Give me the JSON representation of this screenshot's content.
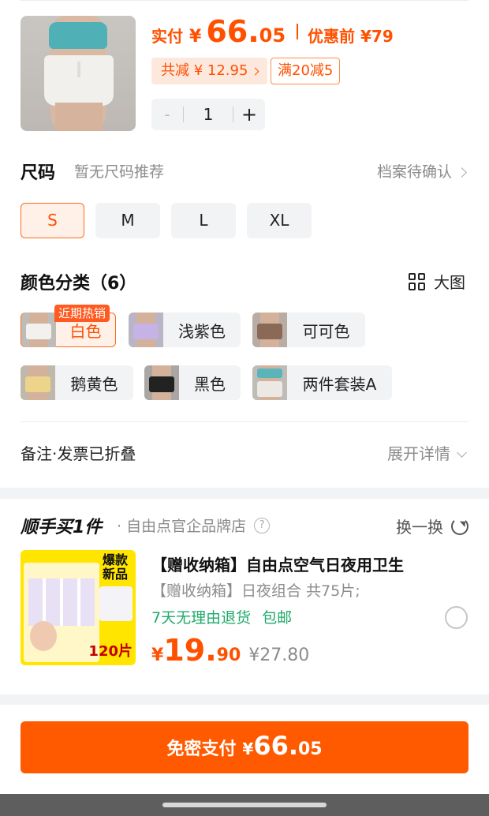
{
  "product": {
    "price_label": "实付",
    "yen": "¥",
    "price_int": "66.",
    "price_dec": "05",
    "orig_label": "优惠前 ¥79",
    "discount_text": "共减 ¥ 12.95",
    "coupon_text": "满20减5",
    "quantity": "1",
    "minus": "-",
    "plus": "+"
  },
  "size": {
    "title": "尺码",
    "subtitle": "暂无尺码推荐",
    "profile_link": "档案待确认",
    "options": [
      "S",
      "M",
      "L",
      "XL"
    ],
    "selected": "S"
  },
  "color": {
    "title": "颜色分类（6）",
    "bigpic_label": "大图",
    "hot_badge": "近期热销",
    "options": [
      "白色",
      "浅紫色",
      "可可色",
      "鹅黄色",
      "黑色",
      "两件套装A"
    ],
    "selected": "白色"
  },
  "remark": {
    "label": "备注·发票已折叠",
    "expand_label": "展开详情"
  },
  "combo": {
    "brand": "顺手买1件",
    "shop": "· 自由点官企品牌店",
    "swap_label": "换一换",
    "title": "【赠收纳箱】自由点空气日夜用卫生",
    "spec": "【赠收纳箱】日夜组合 共75片;",
    "service_return": "7天无理由退货",
    "service_shipping": "包邮",
    "yen": "¥",
    "price_int": "19.",
    "price_dec": "90",
    "orig_price": "¥27.80",
    "img_hot": "爆款新品",
    "img_count": "120片"
  },
  "pay": {
    "label": "免密支付",
    "yen": "¥",
    "price_int": "66.",
    "price_dec": "05"
  },
  "colors": {
    "accent": "#ff5000",
    "pay_button": "#ff5a00",
    "service_green": "#1faa6b"
  }
}
